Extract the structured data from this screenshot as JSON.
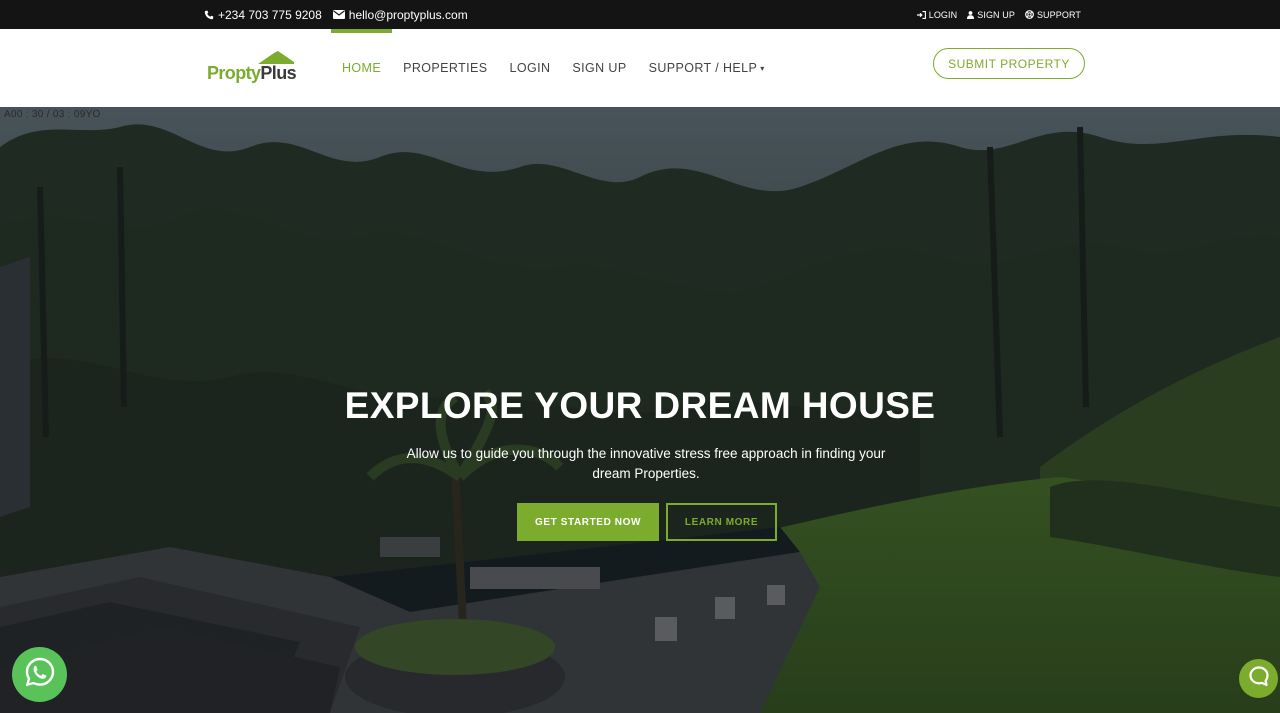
{
  "topbar": {
    "phone": "+234 703 775 9208",
    "email": "hello@proptyplus.com",
    "login": "LOGIN",
    "signup": "SIGN UP",
    "support": "SUPPORT",
    "icons": [
      "phone-icon",
      "envelope-icon",
      "sign-in-icon",
      "user-icon",
      "lifebuoy-icon"
    ]
  },
  "brand": {
    "name_part1": "Propty",
    "name_part2": "Plus",
    "accent_color": "#7cac2e"
  },
  "nav": {
    "items": [
      {
        "label": "HOME",
        "active": true
      },
      {
        "label": "PROPERTIES"
      },
      {
        "label": "LOGIN"
      },
      {
        "label": "SIGN UP"
      },
      {
        "label": "SUPPORT / HELP",
        "dropdown": true
      }
    ],
    "submit_label": "SUBMIT PROPERTY"
  },
  "hero": {
    "timestamp": "A00 : 30 / 03 : 09YO",
    "title": "EXPLORE YOUR DREAM HOUSE",
    "subtitle": "Allow us to guide you through the innovative stress free approach in finding your dream Properties.",
    "primary_button": "GET STARTED NOW",
    "secondary_button": "LEARN MORE"
  },
  "widgets": {
    "whatsapp_icon": "whatsapp-icon",
    "chat_icon": "chat-bubble-icon"
  }
}
